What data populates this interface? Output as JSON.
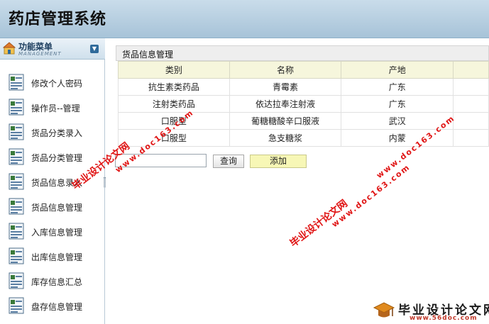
{
  "app": {
    "title": "药店管理系统"
  },
  "sidebar": {
    "header_title": "功能菜单",
    "header_subtitle": "MANAGEMENT",
    "items": [
      {
        "label": "修改个人密码"
      },
      {
        "label": "操作员--管理"
      },
      {
        "label": "货品分类录入"
      },
      {
        "label": "货品分类管理"
      },
      {
        "label": "货品信息录入"
      },
      {
        "label": "货品信息管理"
      },
      {
        "label": "入库信息管理"
      },
      {
        "label": "出库信息管理"
      },
      {
        "label": "库存信息汇总"
      },
      {
        "label": "盘存信息管理"
      }
    ]
  },
  "main": {
    "panel_title": "货品信息管理",
    "columns": [
      "类别",
      "名称",
      "产地",
      ""
    ],
    "rows": [
      [
        "抗生素类药品",
        "青霉素",
        "广东",
        ""
      ],
      [
        "注射类药品",
        "依达拉奉注射液",
        "广东",
        ""
      ],
      [
        "口服型",
        "葡糖糖酸辛口服液",
        "武汉",
        ""
      ],
      [
        "口服型",
        "急支糖浆",
        "内蒙",
        ""
      ]
    ],
    "search": {
      "value": "",
      "placeholder": ""
    },
    "query_button": "查询",
    "add_button": "添加"
  },
  "watermarks": {
    "text": "毕业设计论文网",
    "url": "www.doc163.com"
  },
  "logo": {
    "text": "毕业设计论文网",
    "url": "www.56doc.com"
  },
  "colors": {
    "header_bg": "#b4cde0",
    "table_header_bg": "#f6f6dc",
    "add_button_bg": "#f7f7b6",
    "watermark": "#e01515"
  }
}
